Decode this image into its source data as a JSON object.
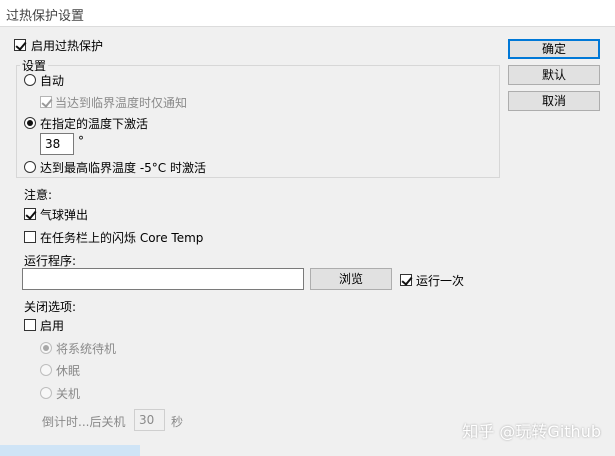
{
  "window": {
    "title": "过热保护设置"
  },
  "enable_protection": {
    "label": "启用过热保护",
    "checked": true
  },
  "buttons": {
    "ok": "确定",
    "default": "默认",
    "cancel": "取消"
  },
  "settings": {
    "legend": "设置",
    "auto": {
      "label": "自动",
      "checked": false
    },
    "notify_only": {
      "label": "当达到临界温度时仅通知",
      "checked": true
    },
    "activate_at_temp": {
      "label": "在指定的温度下激活",
      "checked": true
    },
    "temp_value": "38",
    "temp_unit": "°",
    "activate_at_max": {
      "label": "达到最高临界温度 -5°C 时激活",
      "checked": false
    }
  },
  "notice": {
    "label": "注意:",
    "balloon": {
      "label": "气球弹出",
      "checked": true
    },
    "flash_taskbar": {
      "label": "在任务栏上的闪烁 Core Temp",
      "checked": false
    }
  },
  "run_program": {
    "label": "运行程序:",
    "value": "",
    "browse": "浏览",
    "run_once": {
      "label": "运行一次",
      "checked": true
    }
  },
  "shutdown": {
    "label": "关闭选项:",
    "enable": {
      "label": "启用",
      "checked": false
    },
    "standby": {
      "label": "将系统待机",
      "checked": true
    },
    "hibernate": {
      "label": "休眠",
      "checked": false
    },
    "power_off": {
      "label": "关机",
      "checked": false
    },
    "countdown_label": "倒计时...后关机",
    "countdown_value": "30",
    "countdown_unit": "秒"
  },
  "watermark": "知乎 @玩转Github"
}
